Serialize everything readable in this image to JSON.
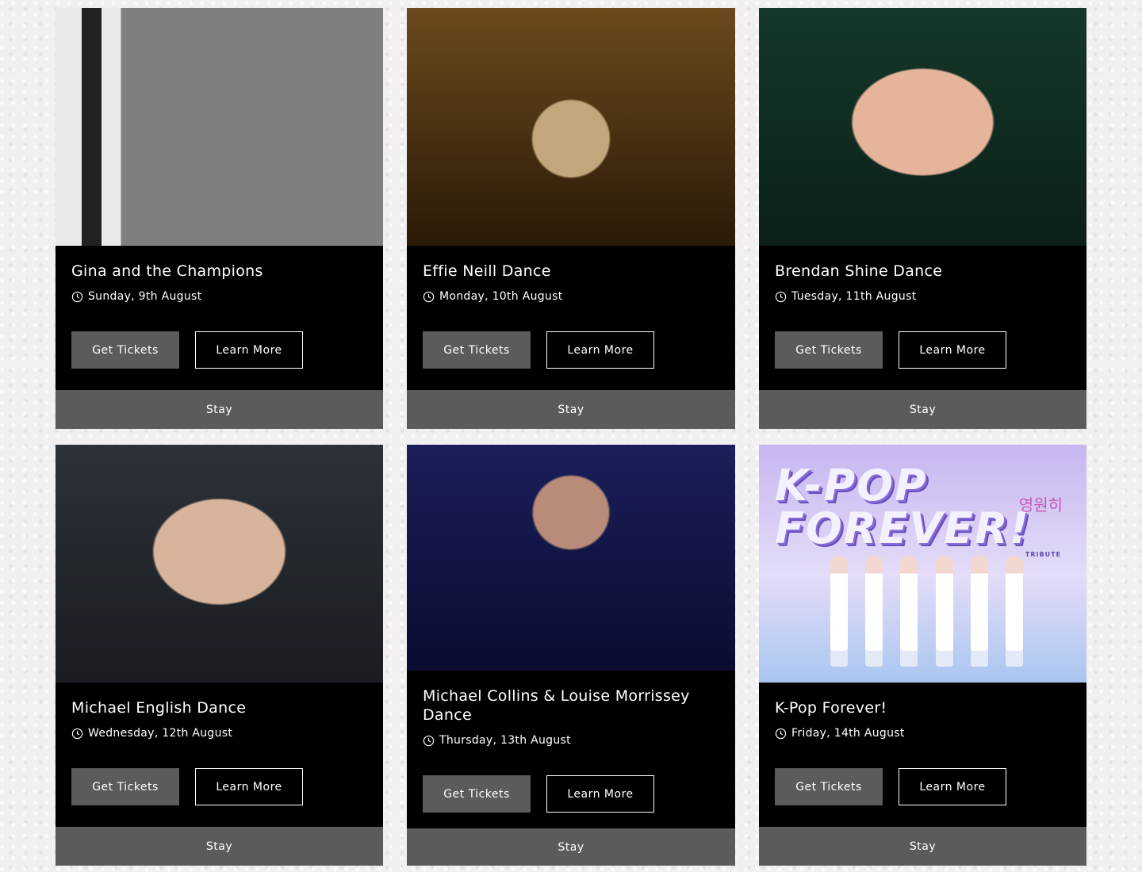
{
  "cards": [
    {
      "title": "Gina and the Champions",
      "date": "Sunday, 9th August",
      "get_tickets": "Get Tickets",
      "learn_more": "Learn More",
      "stay": "Stay"
    },
    {
      "title": "Effie Neill Dance",
      "date": "Monday, 10th August",
      "get_tickets": "Get Tickets",
      "learn_more": "Learn More",
      "stay": "Stay"
    },
    {
      "title": "Brendan Shine Dance",
      "date": "Tuesday, 11th August",
      "get_tickets": "Get Tickets",
      "learn_more": "Learn More",
      "stay": "Stay"
    },
    {
      "title": "Michael English Dance",
      "date": "Wednesday, 12th August",
      "get_tickets": "Get Tickets",
      "learn_more": "Learn More",
      "stay": "Stay"
    },
    {
      "title": "Michael Collins & Louise Morrissey Dance",
      "date": "Thursday, 13th August",
      "get_tickets": "Get Tickets",
      "learn_more": "Learn More",
      "stay": "Stay"
    },
    {
      "title": "K-Pop Forever!",
      "date": "Friday, 14th August",
      "get_tickets": "Get Tickets",
      "learn_more": "Learn More",
      "stay": "Stay"
    }
  ],
  "kpop_poster": {
    "main": "K-POP FOREVER!",
    "sub": "TRIBUTE",
    "korean": "영원히"
  },
  "icons": {
    "date_icon": "clock-icon"
  }
}
